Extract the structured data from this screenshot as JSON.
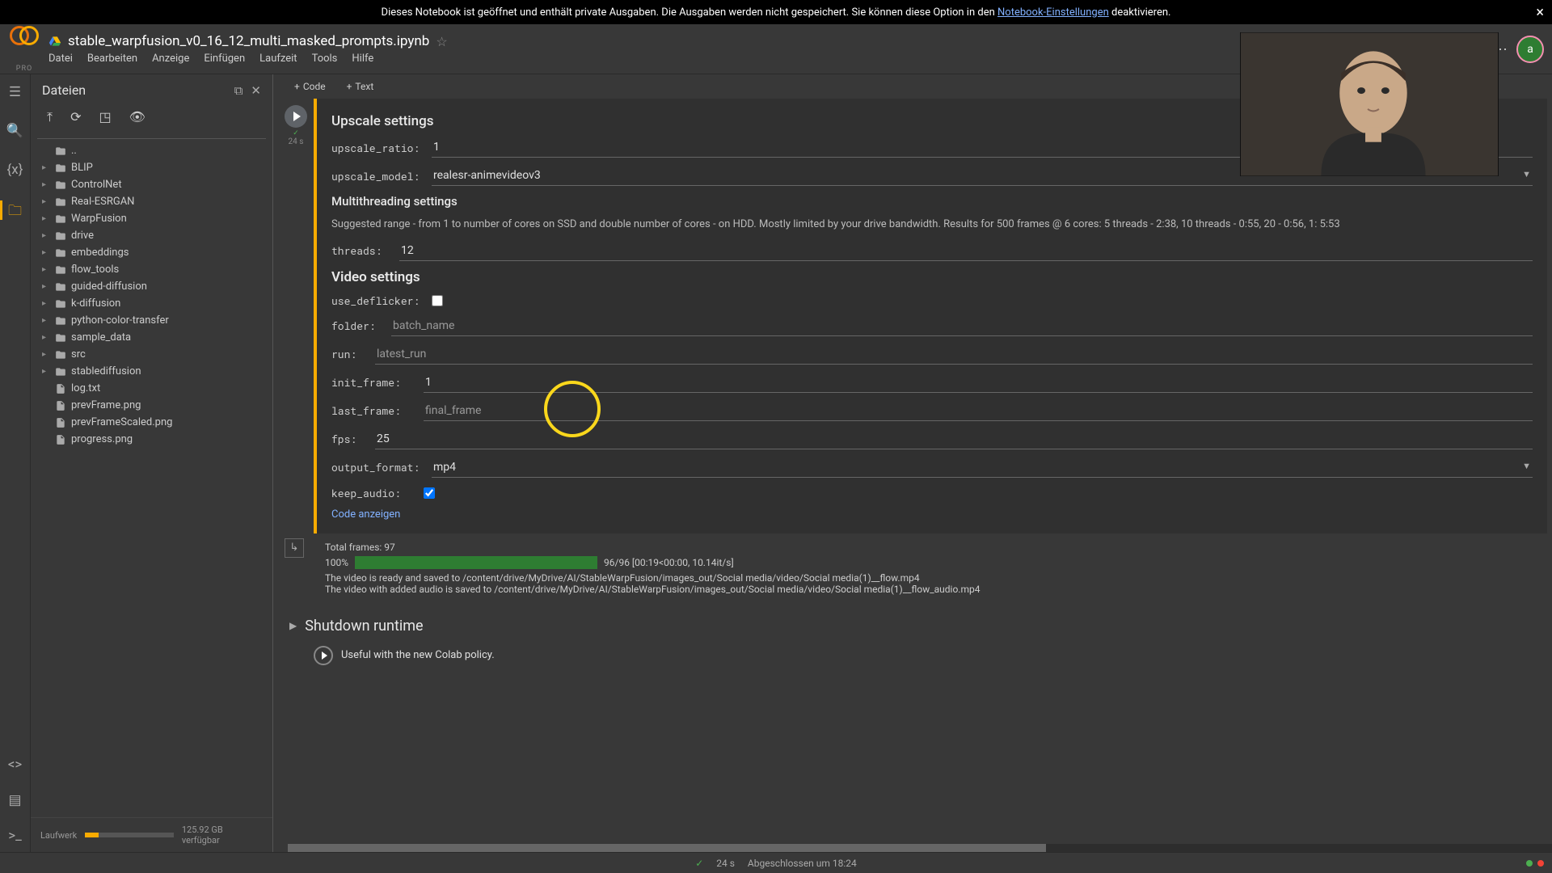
{
  "banner": {
    "text_before": "Dieses Notebook ist geöffnet und enthält private Ausgaben. Die Ausgaben werden nicht gespeichert. Sie können diese Option in den ",
    "link_text": "Notebook-Einstellungen",
    "text_after": " deaktivieren."
  },
  "header": {
    "logo_sub": "PRO",
    "notebook_name": "stable_warpfusion_v0_16_12_multi_masked_prompts.ipynb",
    "avatar_initial": "a"
  },
  "menu": {
    "file": "Datei",
    "edit": "Bearbeiten",
    "view": "Anzeige",
    "insert": "Einfügen",
    "runtime": "Laufzeit",
    "tools": "Tools",
    "help": "Hilfe"
  },
  "insert": {
    "code": "Code",
    "text": "Text"
  },
  "sidebar": {
    "title": "Dateien",
    "parent": "..",
    "folders": [
      "BLIP",
      "ControlNet",
      "Real-ESRGAN",
      "WarpFusion",
      "drive",
      "embeddings",
      "flow_tools",
      "guided-diffusion",
      "k-diffusion",
      "python-color-transfer",
      "sample_data",
      "src",
      "stablediffusion"
    ],
    "files": [
      "log.txt",
      "prevFrame.png",
      "prevFrameScaled.png",
      "progress.png"
    ],
    "disk_label": "Laufwerk",
    "disk_free": "125.92 GB verfügbar"
  },
  "cell": {
    "exec_time": "24 s",
    "upscale_heading": "Upscale settings",
    "upscale_ratio_label": "upscale_ratio:",
    "upscale_ratio_value": "1",
    "upscale_model_label": "upscale_model:",
    "upscale_model_value": "realesr-animevideov3",
    "multithread_heading": "Multithreading settings",
    "multithread_desc": "Suggested range - from 1 to number of cores on SSD and double number of cores - on HDD. Mostly limited by your drive bandwidth. Results for 500 frames @ 6 cores: 5 threads - 2:38, 10 threads - 0:55, 20 - 0:56, 1: 5:53",
    "threads_label": "threads:",
    "threads_value": "12",
    "video_heading": "Video settings",
    "use_deflicker_label": "use_deflicker:",
    "folder_label": "folder:",
    "folder_value": "batch_name",
    "run_label": "run:",
    "run_value": "latest_run",
    "init_frame_label": "init_frame:",
    "init_frame_value": "1",
    "last_frame_label": "last_frame:",
    "last_frame_value": "final_frame",
    "fps_label": "fps:",
    "fps_value": "25",
    "output_format_label": "output_format:",
    "output_format_value": "mp4",
    "keep_audio_label": "keep_audio:",
    "show_code": "Code anzeigen"
  },
  "output": {
    "total_frames": "Total frames: 97",
    "progress_pct": "100%",
    "progress_stats": "96/96 [00:19<00:00, 10.14it/s]",
    "line1": "The video is ready and saved to /content/drive/MyDrive/AI/StableWarpFusion/images_out/Social media/video/Social media(1)__flow.mp4",
    "line2": "The video with added audio is saved to /content/drive/MyDrive/AI/StableWarpFusion/images_out/Social media/video/Social media(1)__flow_audio.mp4"
  },
  "sections": {
    "shutdown": "Shutdown runtime",
    "useful": "Useful with the new Colab policy."
  },
  "status": {
    "duration": "24 s",
    "completed": "Abgeschlossen um 18:24"
  }
}
